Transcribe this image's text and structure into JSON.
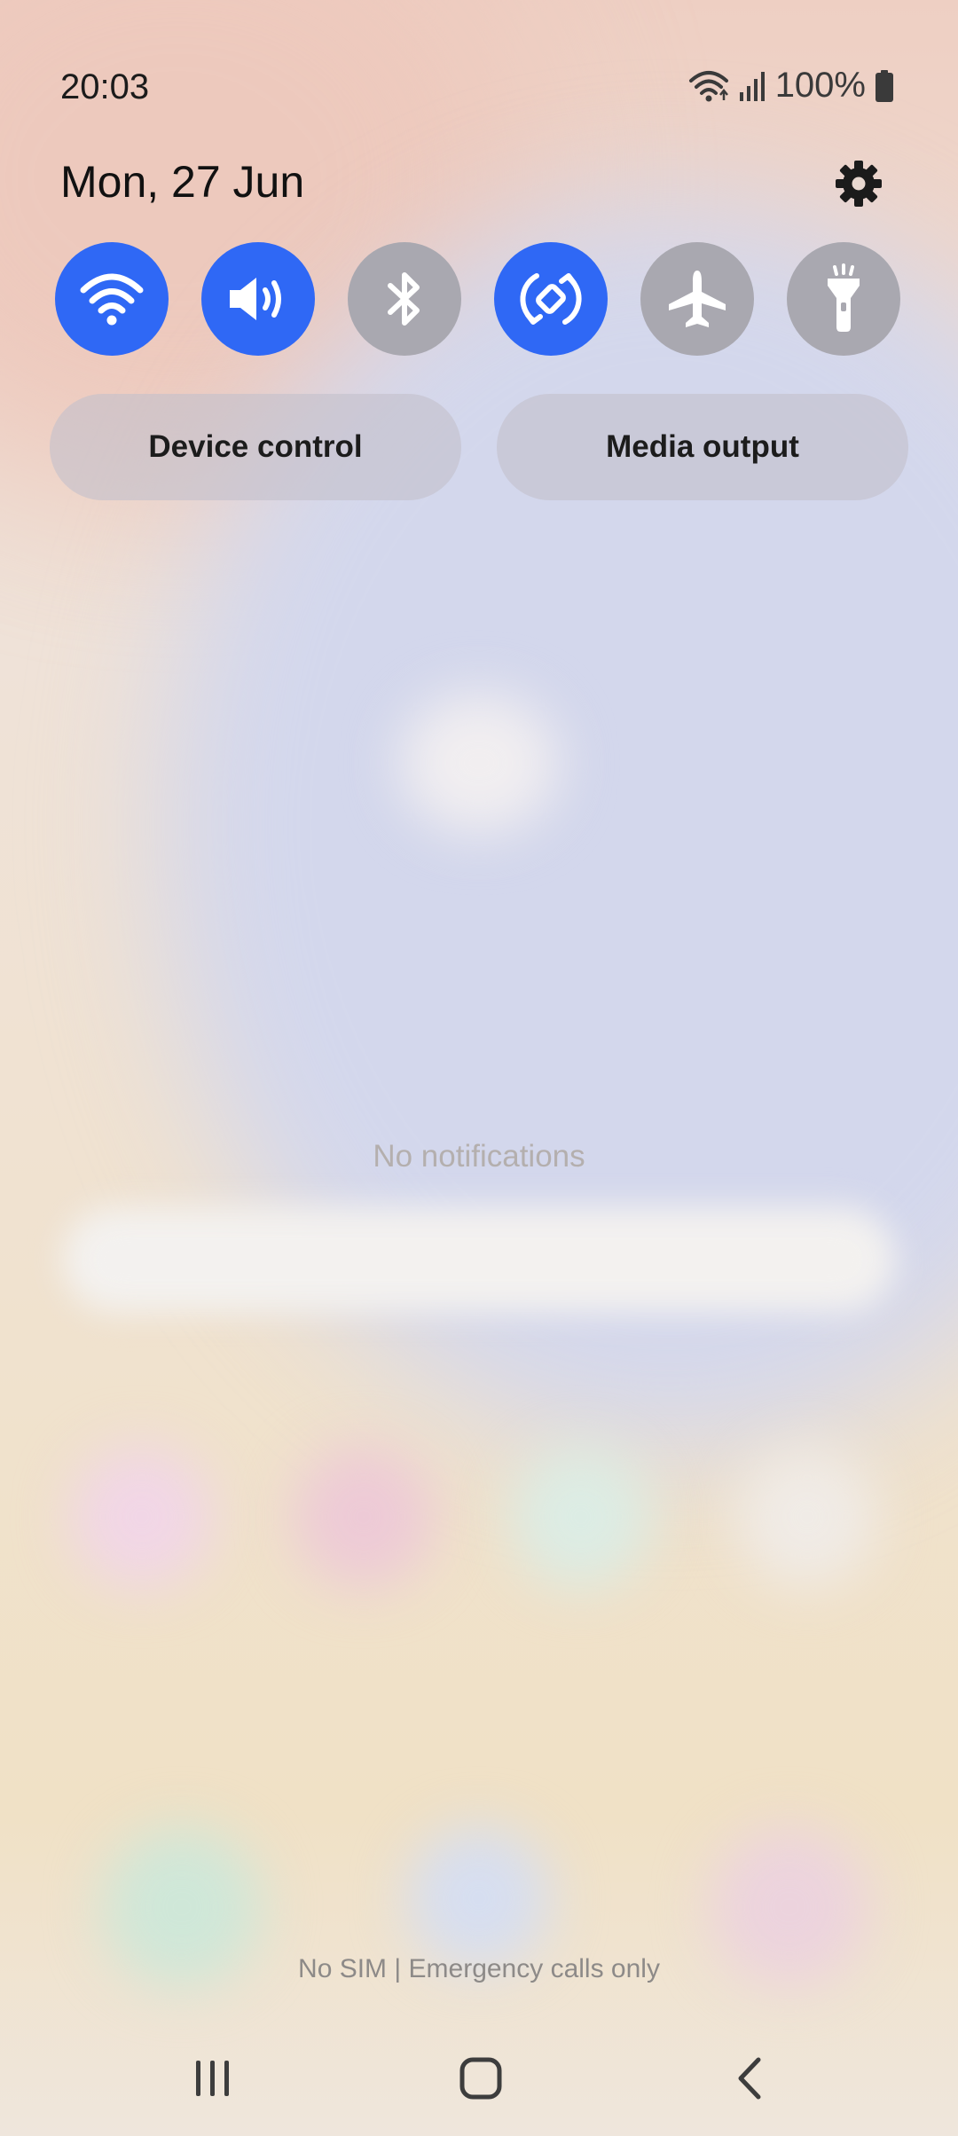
{
  "status_bar": {
    "time": "20:03",
    "battery_percent": "100%",
    "icons": [
      "wifi-icon",
      "signal-icon",
      "battery-icon"
    ]
  },
  "header": {
    "date": "Mon, 27 Jun",
    "settings_icon": "gear-icon"
  },
  "quick_toggles": [
    {
      "name": "Wi-Fi",
      "icon": "wifi-icon",
      "state": "on"
    },
    {
      "name": "Sound",
      "icon": "sound-icon",
      "state": "on"
    },
    {
      "name": "Bluetooth",
      "icon": "bluetooth-icon",
      "state": "off"
    },
    {
      "name": "Auto rotate",
      "icon": "auto-rotate-icon",
      "state": "on"
    },
    {
      "name": "Airplane mode",
      "icon": "airplane-icon",
      "state": "off"
    },
    {
      "name": "Torch",
      "icon": "flashlight-icon",
      "state": "off"
    }
  ],
  "buttons": {
    "device_control": "Device control",
    "media_output": "Media output"
  },
  "notifications": {
    "empty_text": "No notifications"
  },
  "footer": {
    "carrier_text": "No SIM | Emergency calls only"
  },
  "nav_bar": {
    "recents_icon": "recents-icon",
    "home_icon": "home-icon",
    "back_icon": "back-icon"
  },
  "colors": {
    "toggle_on": "#2f68f5",
    "toggle_off": "#a9a8b0"
  }
}
